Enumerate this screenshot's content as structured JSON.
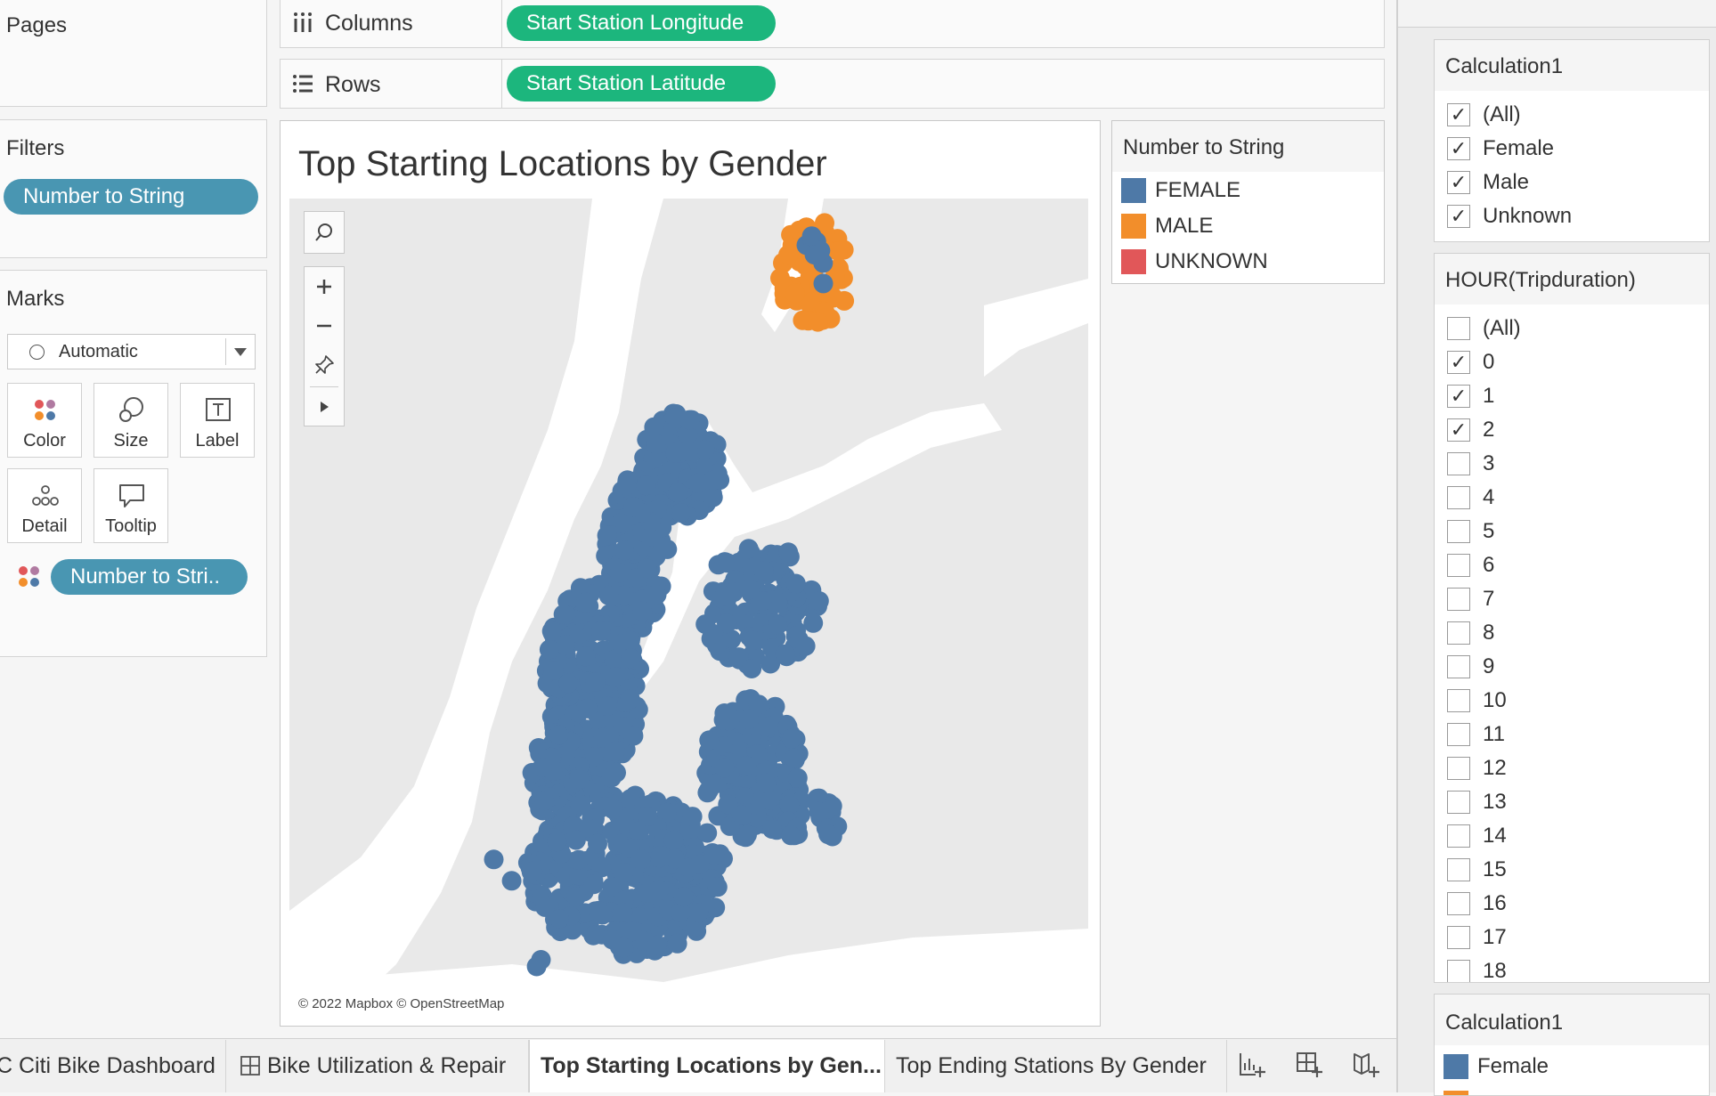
{
  "left": {
    "pages_title": "Pages",
    "filters_title": "Filters",
    "filters_pill": "Number to String",
    "marks_title": "Marks",
    "mark_type": "Automatic",
    "cards": {
      "color": "Color",
      "size": "Size",
      "label": "Label",
      "detail": "Detail",
      "tooltip": "Tooltip"
    },
    "color_pill": "Number to Stri.."
  },
  "shelves": {
    "columns_label": "Columns",
    "columns_pill": "Start Station Longitude",
    "rows_label": "Rows",
    "rows_pill": "Start Station Latitude"
  },
  "view": {
    "title": "Top Starting Locations by Gender",
    "attribution": "© 2022 Mapbox © OpenStreetMap"
  },
  "legend": {
    "title": "Number to String",
    "items": [
      {
        "label": "FEMALE",
        "color": "#4e79a7"
      },
      {
        "label": "MALE",
        "color": "#f28e2b"
      },
      {
        "label": "UNKNOWN",
        "color": "#e15759"
      }
    ]
  },
  "calc_filter": {
    "title": "Calculation1",
    "items": [
      {
        "label": "(All)",
        "checked": true
      },
      {
        "label": "Female",
        "checked": true
      },
      {
        "label": "Male",
        "checked": true
      },
      {
        "label": "Unknown",
        "checked": true
      }
    ]
  },
  "hour_filter": {
    "title": "HOUR(Tripduration)",
    "items": [
      {
        "label": "(All)",
        "checked": false
      },
      {
        "label": "0",
        "checked": true
      },
      {
        "label": "1",
        "checked": true
      },
      {
        "label": "2",
        "checked": true
      },
      {
        "label": "3",
        "checked": false
      },
      {
        "label": "4",
        "checked": false
      },
      {
        "label": "5",
        "checked": false
      },
      {
        "label": "6",
        "checked": false
      },
      {
        "label": "7",
        "checked": false
      },
      {
        "label": "8",
        "checked": false
      },
      {
        "label": "9",
        "checked": false
      },
      {
        "label": "10",
        "checked": false
      },
      {
        "label": "11",
        "checked": false
      },
      {
        "label": "12",
        "checked": false
      },
      {
        "label": "13",
        "checked": false
      },
      {
        "label": "14",
        "checked": false
      },
      {
        "label": "15",
        "checked": false
      },
      {
        "label": "16",
        "checked": false
      },
      {
        "label": "17",
        "checked": false
      },
      {
        "label": "18",
        "checked": false
      }
    ]
  },
  "calc_legend": {
    "title": "Calculation1",
    "items": [
      {
        "label": "Female",
        "color": "#4e79a7"
      }
    ]
  },
  "tabs": [
    {
      "label": "C Citi Bike Dashboard",
      "active": false,
      "icon": ""
    },
    {
      "label": "Bike Utilization & Repair",
      "active": false,
      "icon": "grid-icon"
    },
    {
      "label": "Top Starting Locations by Gen...",
      "active": true,
      "icon": ""
    },
    {
      "label": "Top Ending Stations By Gender",
      "active": false,
      "icon": ""
    }
  ],
  "tab_icons": [
    "new-worksheet-icon",
    "new-dashboard-icon",
    "new-story-icon"
  ]
}
